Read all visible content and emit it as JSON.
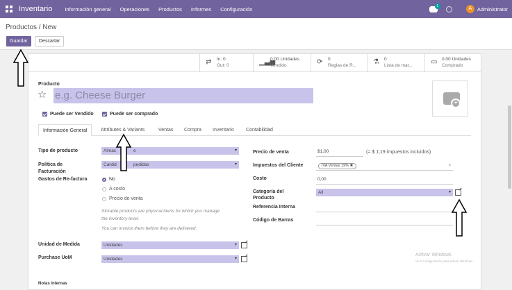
{
  "navbar": {
    "brand": "Inventario",
    "menus": [
      "Información general",
      "Operaciones",
      "Productos",
      "Informes",
      "Configuración"
    ],
    "chat_badge": "1",
    "avatar_letter": "A",
    "user": "Administrator"
  },
  "control": {
    "breadcrumb": "Productos / New",
    "save_label": "Guardar",
    "discard_label": "Descartar"
  },
  "stats": [
    {
      "line1": "In:   0",
      "line2": "Out:  0"
    },
    {
      "line1": "0,00 Unidades",
      "line2": "Vendido"
    },
    {
      "line1": "0",
      "line2": "Reglas de R..."
    },
    {
      "line1": "0",
      "line2": "Lista de mat..."
    },
    {
      "line1": "0,00 Unidades",
      "line2": "Comprado"
    }
  ],
  "product": {
    "label": "Producto",
    "name_placeholder": "e.g. Cheese Burger",
    "can_be_sold": "Puede ser Vendido",
    "can_be_purchased": "Puede ser comprado"
  },
  "tabs": [
    "Información General",
    "Attributes & Variants",
    "Ventas",
    "Compra",
    "Inventario",
    "Contabilidad"
  ],
  "left": {
    "product_type_label": "Tipo de producto",
    "product_type_value": "Almac",
    "product_type_value_end": "e",
    "invoice_policy_label": "Política de Facturación",
    "invoice_policy_value": "Cantid",
    "invoice_policy_value_end": "pedidas",
    "reinvoice_label": "Gastos de Re-factura",
    "reinvoice_options": [
      "No",
      "A costo",
      "Precio de venta"
    ],
    "note1a": "Storable products are physical items for which you manage",
    "note1b": "the inventory level.",
    "note2": "You can invoice them before they are delivered.",
    "uom_label": "Unidad de Medida",
    "uom_value": "Unidades",
    "purchase_uom_label": "Purchase UoM",
    "purchase_uom_value": "Unidades"
  },
  "right": {
    "price_label": "Precio de venta",
    "price_value": "$1,00",
    "price_note": "(= $ 1,19 impuestos incluidos)",
    "taxes_label": "Impuestos del Cliente",
    "tax_tag": "IVA Ventas 19% ✖",
    "cost_label": "Costo",
    "cost_value": "0,00",
    "category_label": "Categoría del Producto",
    "category_value": "All",
    "internal_ref_label": "Referencia Interna",
    "barcode_label": "Código de Barras"
  },
  "internal_notes_label": "Notas internas",
  "watermark": {
    "line1": "Activar Windows",
    "line2": "Ve a Configuración para activar Windows."
  },
  "colors": {
    "brand": "#71639e",
    "field_highlight": "#c8c3ea"
  }
}
